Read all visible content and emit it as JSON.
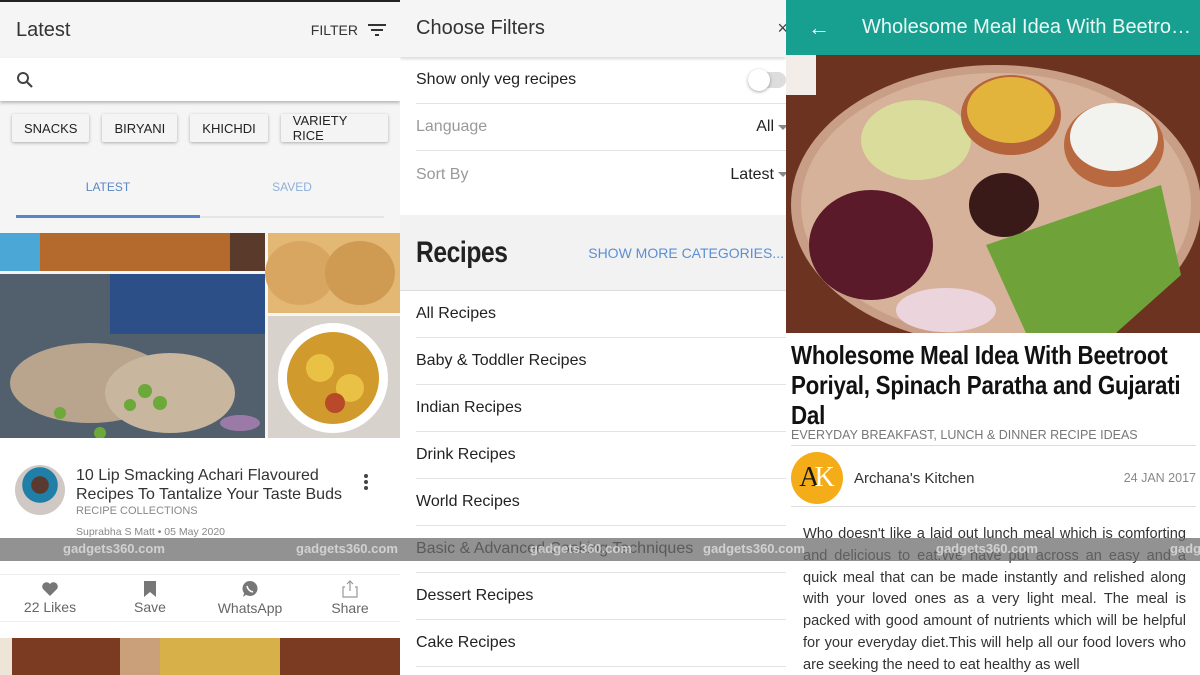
{
  "feed": {
    "title": "Latest",
    "filter_label": "FILTER",
    "search_placeholder": "",
    "chips": [
      "SNACKS",
      "BIRYANI",
      "KHICHDI",
      "VARIETY RICE"
    ],
    "tabs": [
      {
        "label": "LATEST",
        "active": true
      },
      {
        "label": "SAVED",
        "active": false
      }
    ],
    "card": {
      "title": "10 Lip Smacking Achari Flavoured Recipes To Tantalize Your Taste Buds",
      "category": "RECIPE COLLECTIONS",
      "meta": "Suprabha S Matt • 05 May 2020",
      "actions": [
        {
          "label": "22 Likes",
          "icon": "heart-icon"
        },
        {
          "label": "Save",
          "icon": "bookmark-icon"
        },
        {
          "label": "WhatsApp",
          "icon": "whatsapp-icon"
        },
        {
          "label": "Share",
          "icon": "share-icon"
        }
      ]
    }
  },
  "filters": {
    "title": "Choose Filters",
    "close_icon": "×",
    "veg_label": "Show only veg recipes",
    "veg_enabled": false,
    "language_label": "Language",
    "language_value": "All",
    "sort_label": "Sort By",
    "sort_value": "Latest",
    "recipes_heading": "Recipes",
    "show_more": "SHOW MORE CATEGORIES...",
    "categories": [
      "All Recipes",
      "Baby & Toddler Recipes",
      "Indian Recipes",
      "Drink Recipes",
      "World Recipes",
      "Basic & Advanced Cooking Techniques",
      "Dessert Recipes",
      "Cake Recipes"
    ]
  },
  "article": {
    "header_title": "Wholesome Meal Idea With Beetroot Poriyal, Spinach Paratha and Gujarati Dal",
    "title": "Wholesome Meal Idea With Beetroot Poriyal, Spinach Paratha and Gujarati Dal",
    "category": "EVERYDAY BREAKFAST, LUNCH & DINNER RECIPE IDEAS",
    "author": "Archana's Kitchen",
    "author_initials_a": "A",
    "author_initials_k": "K",
    "date": "24 JAN 2017",
    "body": "Who doesn't like a laid out lunch meal which is comforting and delicious to eat.We have put across an easy and a quick meal that can be made instantly and relished along with your loved ones as a very light meal. The meal is packed with good amount of nutrients which will be helpful for your everyday diet.This will help all our food lovers who are seeking the need to eat healthy as well"
  },
  "watermark": "gadgets360.com",
  "colors": {
    "accent_blue": "#5b86c4",
    "teal_header": "#17a08f",
    "logo_orange": "#f4ad19"
  }
}
